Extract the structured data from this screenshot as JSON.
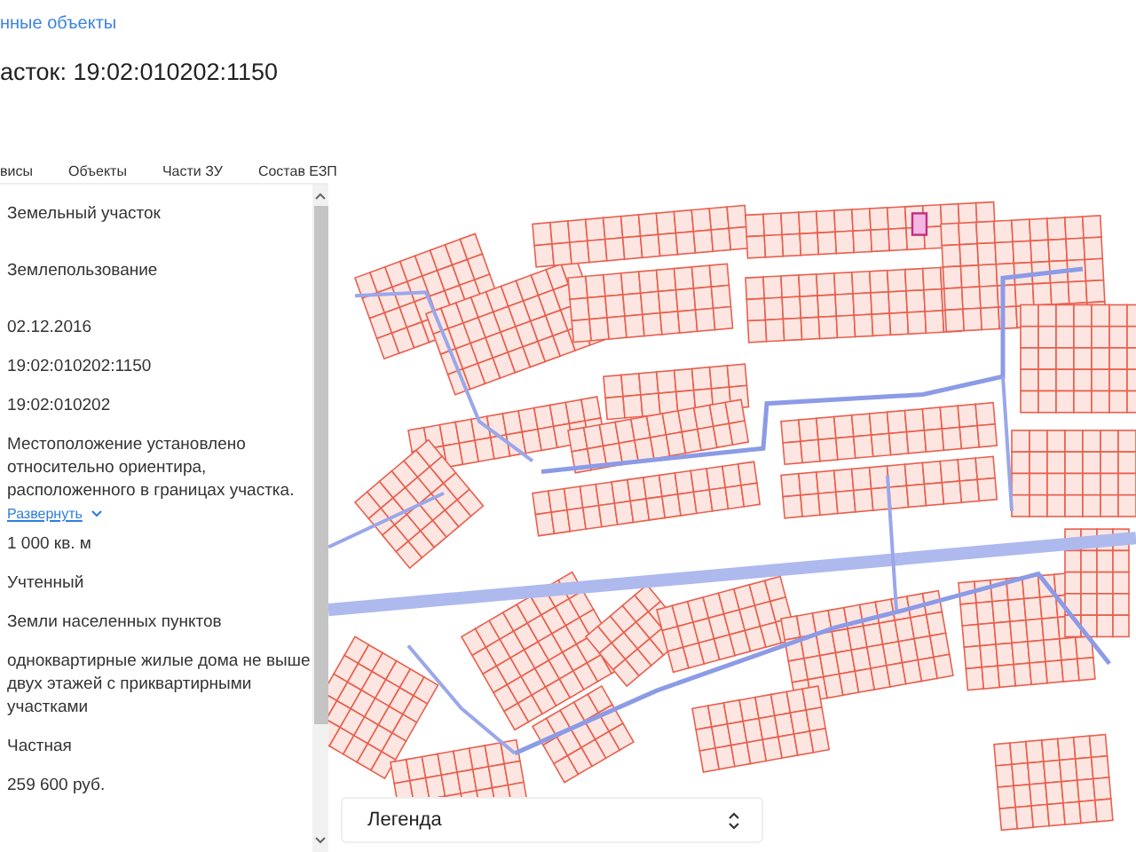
{
  "breadcrumb": "нные объекты",
  "title": "асток: 19:02:010202:1150",
  "tabs": [
    {
      "label": "висы"
    },
    {
      "label": "Объекты"
    },
    {
      "label": "Части ЗУ"
    },
    {
      "label": "Состав ЕЗП"
    }
  ],
  "fields": [
    {
      "value": "Земельный участок"
    },
    {
      "value": "Землепользование"
    },
    {
      "value": "02.12.2016"
    },
    {
      "value": "19:02:010202:1150"
    },
    {
      "value": "19:02:010202"
    },
    {
      "value": "Местоположение установлено относительно ориентира, расположенного в границах участка.",
      "expand_link": "Развернуть"
    },
    {
      "value": "1 000 кв. м"
    },
    {
      "value": "Учтенный"
    },
    {
      "value": "Земли населенных пунктов"
    },
    {
      "value": "одноквартирные жилые дома не выше двух этажей с приквартирными участками"
    },
    {
      "value": "Частная"
    },
    {
      "value": "259 600 руб."
    }
  ],
  "legend": {
    "label": "Легенда"
  }
}
